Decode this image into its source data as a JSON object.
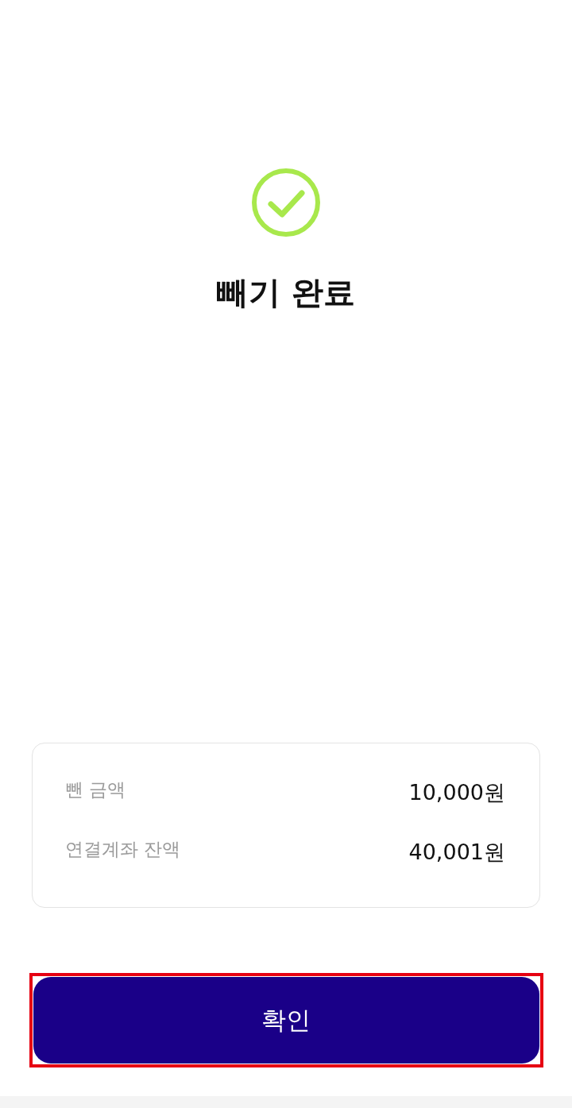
{
  "status": {
    "kind": "success",
    "title": "빼기 완료"
  },
  "summary": {
    "rows": [
      {
        "label": "뺀 금액",
        "value": "10,000원"
      },
      {
        "label": "연결계좌 잔액",
        "value": "40,001원"
      }
    ]
  },
  "confirm_button": {
    "label": "확인",
    "highlighted": true
  }
}
